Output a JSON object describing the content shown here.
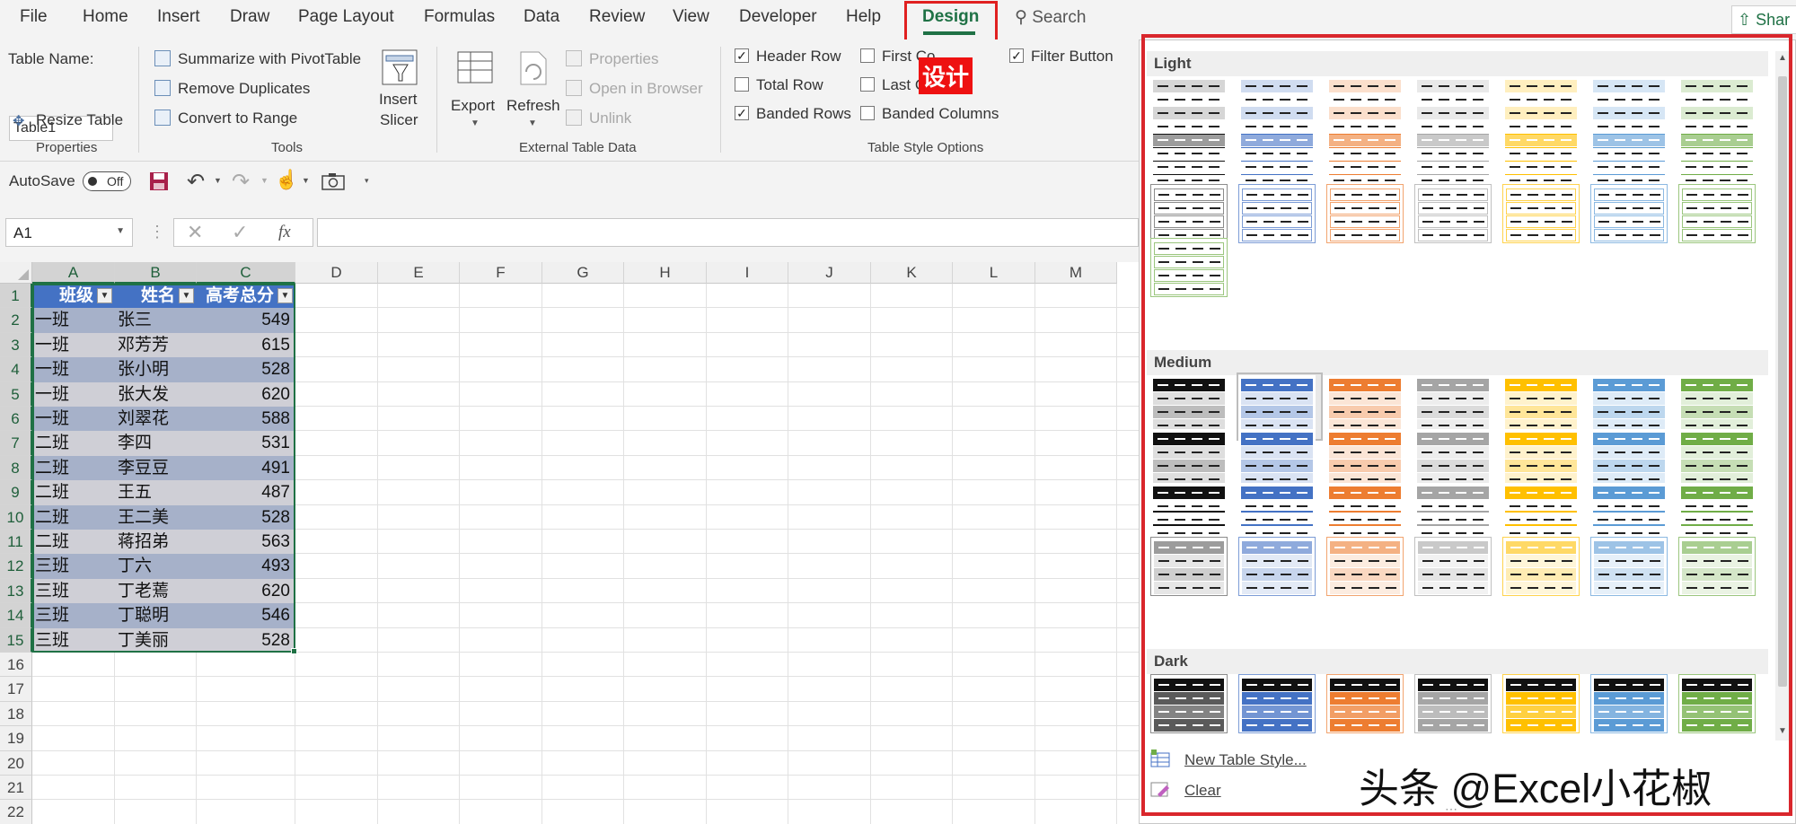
{
  "tabs": [
    "File",
    "Home",
    "Insert",
    "Draw",
    "Page Layout",
    "Formulas",
    "Data",
    "Review",
    "View",
    "Developer",
    "Help",
    "Design"
  ],
  "search": {
    "label": "Search"
  },
  "share": {
    "label": "Shar"
  },
  "design_cn_label": "设计",
  "properties": {
    "table_name_label": "Table Name:",
    "table_name_value": "Table1",
    "resize_label": "Resize Table",
    "group_label": "Properties"
  },
  "tools": {
    "pivot_label": "Summarize with PivotTable",
    "dup_label": "Remove Duplicates",
    "range_label": "Convert to Range",
    "slicer_label_1": "Insert",
    "slicer_label_2": "Slicer",
    "group_label": "Tools"
  },
  "external": {
    "export_label": "Export",
    "refresh_label": "Refresh",
    "properties_label": "Properties",
    "browser_label": "Open in Browser",
    "unlink_label": "Unlink",
    "group_label": "External Table Data"
  },
  "style_options": {
    "header_row": "Header Row",
    "total_row": "Total Row",
    "banded_rows": "Banded Rows",
    "first_column": "First Co",
    "last_column": "Last C",
    "banded_columns": "Banded Columns",
    "filter_button": "Filter Button",
    "group_label": "Table Style Options"
  },
  "qat": {
    "autosave_label": "AutoSave",
    "autosave_state": "Off"
  },
  "formula_bar": {
    "name_box": "A1",
    "fx": "fx"
  },
  "columns": [
    "A",
    "B",
    "C",
    "D",
    "E",
    "F",
    "G",
    "H",
    "I",
    "J",
    "K",
    "L",
    "M"
  ],
  "rows": [
    "1",
    "2",
    "3",
    "4",
    "5",
    "6",
    "7",
    "8",
    "9",
    "10",
    "11",
    "12",
    "13",
    "14",
    "15",
    "16",
    "17",
    "18",
    "19",
    "20",
    "21",
    "22"
  ],
  "table": {
    "headers": [
      "班级",
      "姓名",
      "高考总分"
    ],
    "data": [
      [
        "一班",
        "张三",
        "549"
      ],
      [
        "一班",
        "邓芳芳",
        "615"
      ],
      [
        "一班",
        "张小明",
        "528"
      ],
      [
        "一班",
        "张大发",
        "620"
      ],
      [
        "一班",
        "刘翠花",
        "588"
      ],
      [
        "二班",
        "李四",
        "531"
      ],
      [
        "二班",
        "李豆豆",
        "491"
      ],
      [
        "二班",
        "王五",
        "487"
      ],
      [
        "二班",
        "王二美",
        "528"
      ],
      [
        "二班",
        "蒋招弟",
        "563"
      ],
      [
        "三班",
        "丁六",
        "493"
      ],
      [
        "三班",
        "丁老蔫",
        "620"
      ],
      [
        "三班",
        "丁聪明",
        "546"
      ],
      [
        "三班",
        "丁美丽",
        "528"
      ]
    ]
  },
  "gallery": {
    "sections": [
      "Light",
      "Medium",
      "Dark"
    ],
    "new_style_label": "New Table Style...",
    "clear_label": "Clear",
    "colors": [
      "#5a5a5a",
      "#4472c4",
      "#ed7d31",
      "#a5a5a5",
      "#ffc000",
      "#5b9bd5",
      "#70ad47"
    ]
  },
  "watermark": "头条 @Excel小花椒"
}
